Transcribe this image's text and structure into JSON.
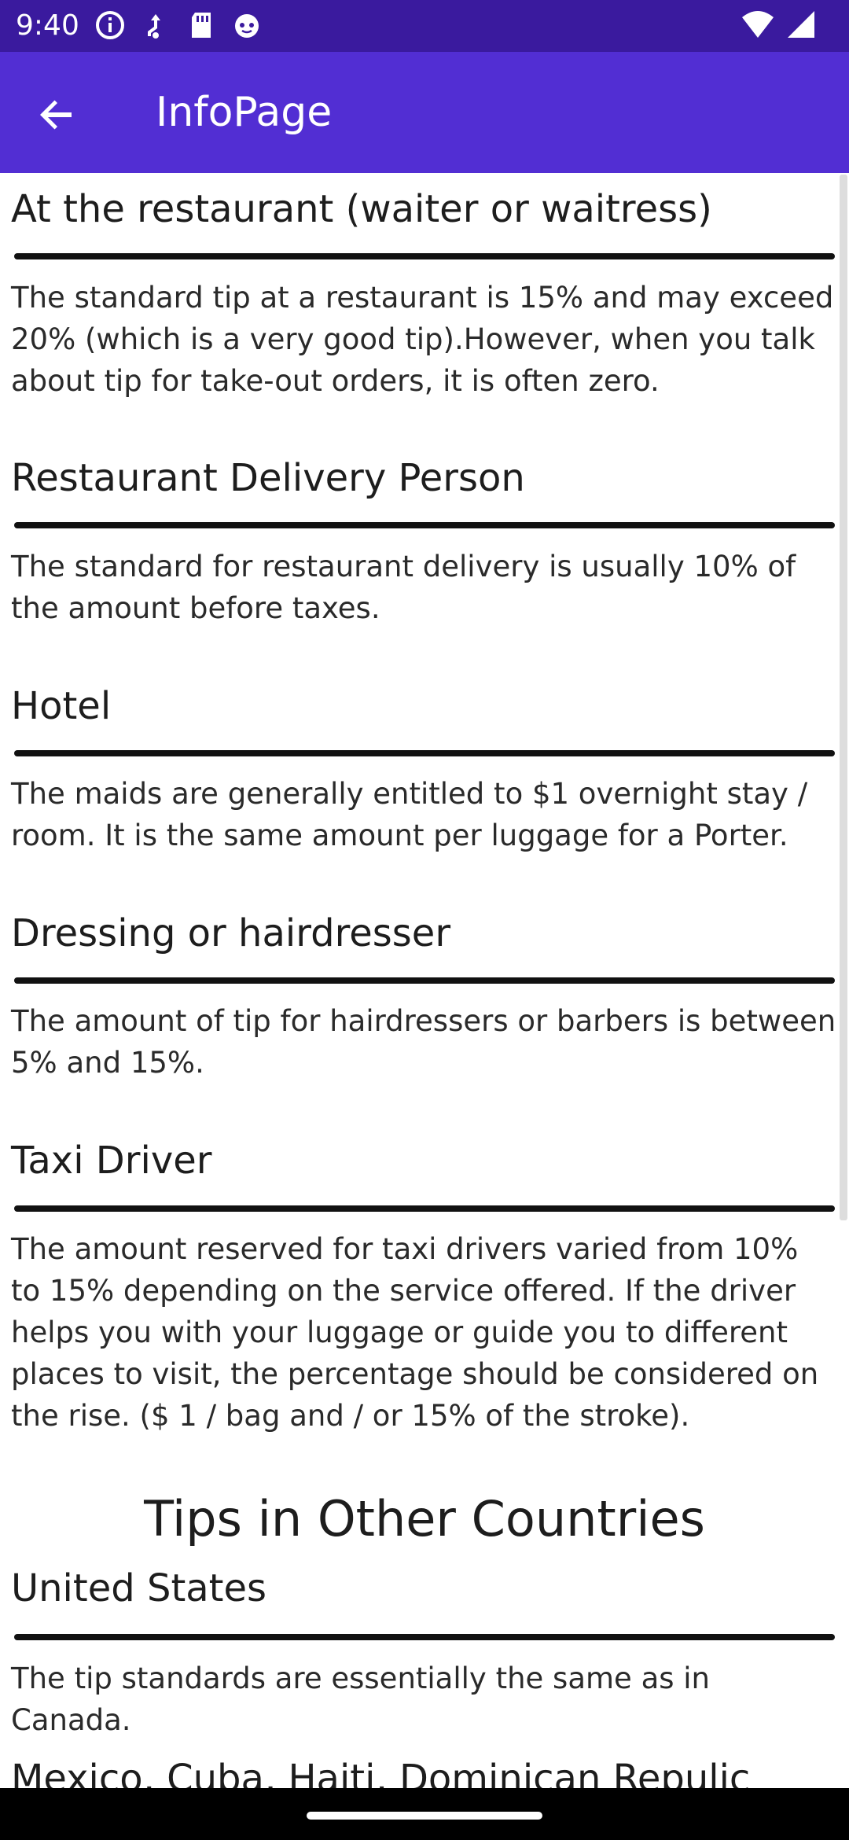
{
  "status_bar": {
    "time": "9:40",
    "icons": [
      "info-icon",
      "usb-debug-icon",
      "sd-card-icon",
      "cat-face-icon"
    ],
    "right_icons": [
      "wifi-icon",
      "cellular-signal-icon"
    ]
  },
  "app_bar": {
    "title": "InfoPage",
    "back_icon": "arrow-back-icon"
  },
  "sections": [
    {
      "title": "At the restaurant (waiter or waitress)",
      "body": "The standard tip at a restaurant is 15% and may exceed 20% (which is a very good tip).However, when you talk about tip for take-out orders, it is often zero."
    },
    {
      "title": "Restaurant Delivery Person",
      "body": "The standard for restaurant delivery is usually 10% of the amount before taxes."
    },
    {
      "title": "Hotel",
      "body": "The maids are generally entitled to $1 overnight stay / room. It is the same amount per luggage for a Porter."
    },
    {
      "title": "Dressing or hairdresser",
      "body": "The amount of tip for hairdressers or barbers is between 5% and 15%."
    },
    {
      "title": "Taxi Driver",
      "body": "The amount reserved for taxi drivers varied from 10% to 15% depending on the service offered. If the driver helps you with your luggage or guide you to different places to visit, the percentage should be considered on the rise. ($ 1 / bag and / or 15% of the stroke)."
    }
  ],
  "other_countries": {
    "heading": "Tips in Other Countries",
    "sections": [
      {
        "title": "United States",
        "body": "The tip standards are essentially the same as in Canada."
      },
      {
        "title": "Mexico, Cuba, Haiti, Dominican Repulic",
        "body": ""
      }
    ]
  }
}
